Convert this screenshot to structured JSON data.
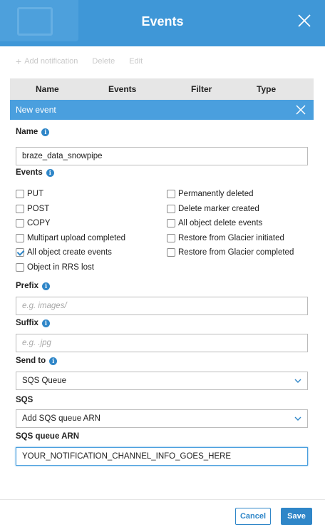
{
  "header": {
    "title": "Events"
  },
  "toolbar": {
    "add_label": "Add notification",
    "delete_label": "Delete",
    "edit_label": "Edit"
  },
  "table": {
    "columns": [
      "Name",
      "Events",
      "Filter",
      "Type"
    ]
  },
  "panel": {
    "title": "New event"
  },
  "name_field": {
    "label": "Name",
    "value": "braze_data_snowpipe"
  },
  "events": {
    "label": "Events",
    "options_left": [
      {
        "label": "PUT",
        "checked": false
      },
      {
        "label": "POST",
        "checked": false
      },
      {
        "label": "COPY",
        "checked": false
      },
      {
        "label": "Multipart upload completed",
        "checked": false
      },
      {
        "label": "All object create events",
        "checked": true
      },
      {
        "label": "Object in RRS lost",
        "checked": false
      }
    ],
    "options_right": [
      {
        "label": "Permanently deleted",
        "checked": false
      },
      {
        "label": "Delete marker created",
        "checked": false
      },
      {
        "label": "All object delete events",
        "checked": false
      },
      {
        "label": "Restore from Glacier initiated",
        "checked": false
      },
      {
        "label": "Restore from Glacier completed",
        "checked": false
      }
    ]
  },
  "prefix": {
    "label": "Prefix",
    "placeholder": "e.g. images/"
  },
  "suffix": {
    "label": "Suffix",
    "placeholder": "e.g. .jpg"
  },
  "send_to": {
    "label": "Send to",
    "value": "SQS Queue"
  },
  "sqs": {
    "label": "SQS",
    "value": "Add SQS queue ARN"
  },
  "sqs_arn": {
    "label": "SQS queue ARN",
    "value": "YOUR_NOTIFICATION_CHANNEL_INFO_GOES_HERE"
  },
  "buttons": {
    "cancel": "Cancel",
    "save": "Save"
  },
  "colors": {
    "header": "#3f97d7",
    "subheader": "#4a9fde",
    "accent": "#2f86c8"
  },
  "icons": {
    "close": "close-icon",
    "info": "info-icon",
    "add": "plus-icon",
    "dropdown": "chevron-down-icon"
  }
}
